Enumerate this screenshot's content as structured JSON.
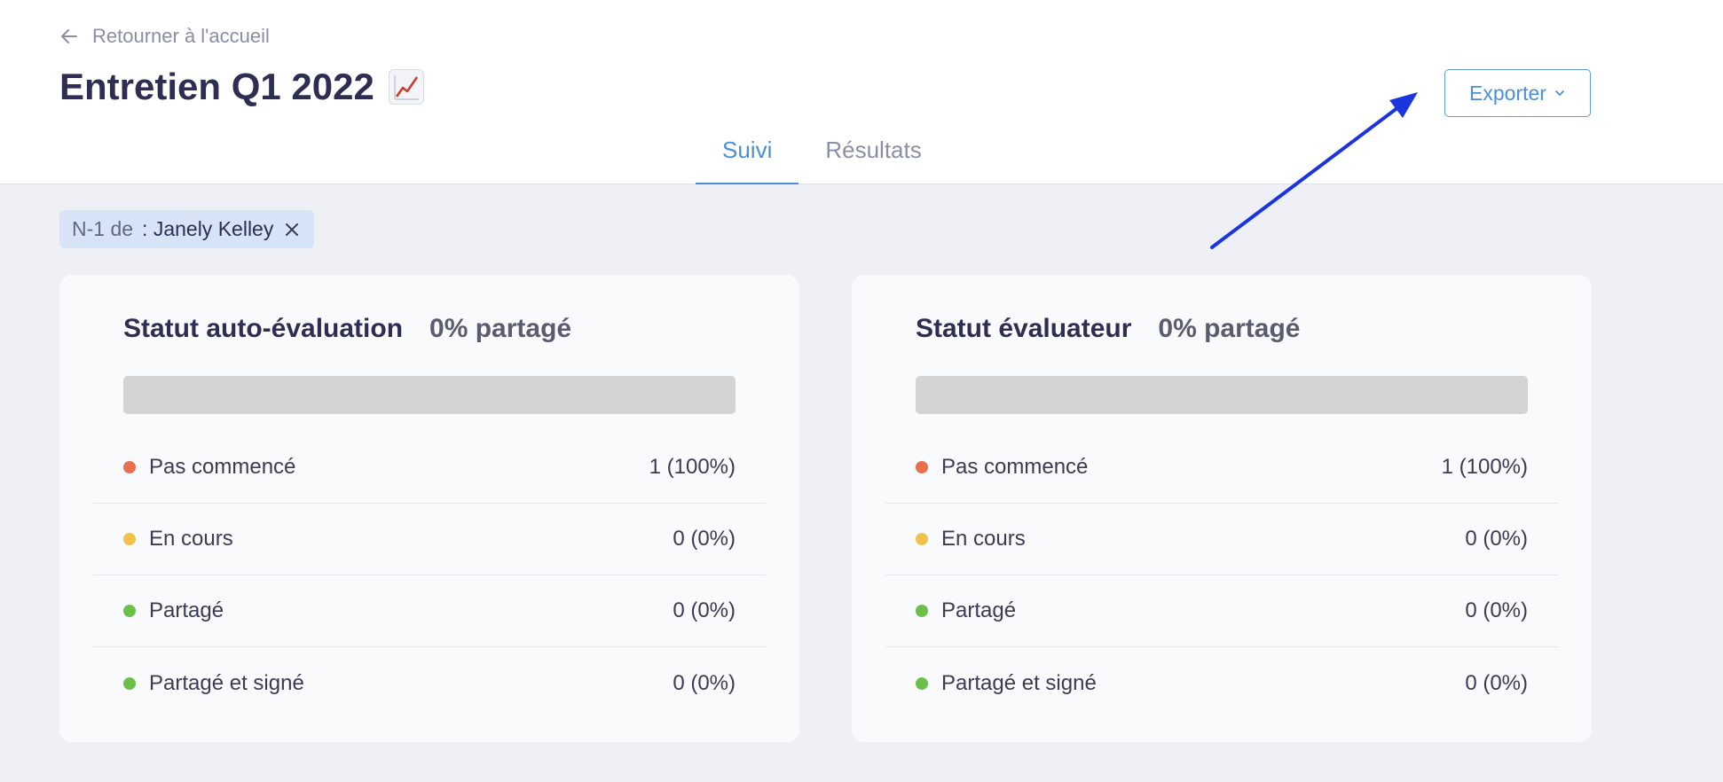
{
  "header": {
    "back_label": "Retourner à l'accueil",
    "title": "Entretien Q1 2022",
    "title_emoji": "chart-increasing-icon",
    "export_label": "Exporter",
    "tabs": [
      {
        "label": "Suivi",
        "active": true
      },
      {
        "label": "Résultats",
        "active": false
      }
    ]
  },
  "filter": {
    "label": "N-1 de",
    "value": ": Janely Kelley"
  },
  "cards": [
    {
      "title": "Statut auto-évaluation",
      "percent_label": "0% partagé",
      "progress_shared": 0,
      "rows": [
        {
          "label": "Pas commencé",
          "value": "1 (100%)",
          "color": "#e8704f"
        },
        {
          "label": "En cours",
          "value": "0 (0%)",
          "color": "#f0c24a"
        },
        {
          "label": "Partagé",
          "value": "0 (0%)",
          "color": "#6cc04a"
        },
        {
          "label": "Partagé et signé",
          "value": "0 (0%)",
          "color": "#6cc04a"
        }
      ]
    },
    {
      "title": "Statut évaluateur",
      "percent_label": "0% partagé",
      "progress_shared": 0,
      "rows": [
        {
          "label": "Pas commencé",
          "value": "1 (100%)",
          "color": "#e8704f"
        },
        {
          "label": "En cours",
          "value": "0 (0%)",
          "color": "#f0c24a"
        },
        {
          "label": "Partagé",
          "value": "0 (0%)",
          "color": "#6cc04a"
        },
        {
          "label": "Partagé et signé",
          "value": "0 (0%)",
          "color": "#6cc04a"
        }
      ]
    }
  ],
  "colors": {
    "accent": "#4a90d9",
    "annotation_arrow": "#1a35e0"
  }
}
